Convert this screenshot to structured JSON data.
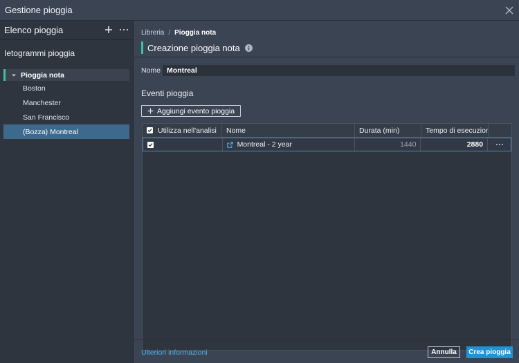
{
  "window": {
    "title": "Gestione pioggia"
  },
  "sidebar": {
    "header_title": "Elenco pioggia",
    "section_title": "Ietogrammi pioggia",
    "parent_item": "Pioggia nota",
    "items": [
      {
        "label": "Boston",
        "selected": false
      },
      {
        "label": "Manchester",
        "selected": false
      },
      {
        "label": "San Francisco",
        "selected": false
      },
      {
        "label": "(Bozza) Montreal",
        "selected": true
      }
    ]
  },
  "main": {
    "breadcrumb": {
      "root": "Libreria",
      "separator": "/",
      "current": "Pioggia nota"
    },
    "page_title": "Creazione pioggia nota",
    "name_label": "Nome",
    "name_value": "Montreal",
    "events_title": "Eventi pioggia",
    "add_event_label": "Aggiungi evento pioggia",
    "table": {
      "columns": [
        "Utilizza nell'analisi",
        "Nome",
        "Durata (min)",
        "Tempo di esecuzion..."
      ],
      "rows": [
        {
          "use": true,
          "name": "Montreal - 2 year",
          "duration": "1440",
          "runtime": "2880"
        }
      ]
    },
    "footer": {
      "more_info": "Ulteriori informazioni",
      "cancel": "Annulla",
      "create": "Crea pioggia"
    }
  },
  "colors": {
    "accent_green": "#3fc1a0",
    "selection_blue": "#3d6a8c",
    "primary_button": "#1e94d6",
    "link": "#4fb0e8"
  }
}
